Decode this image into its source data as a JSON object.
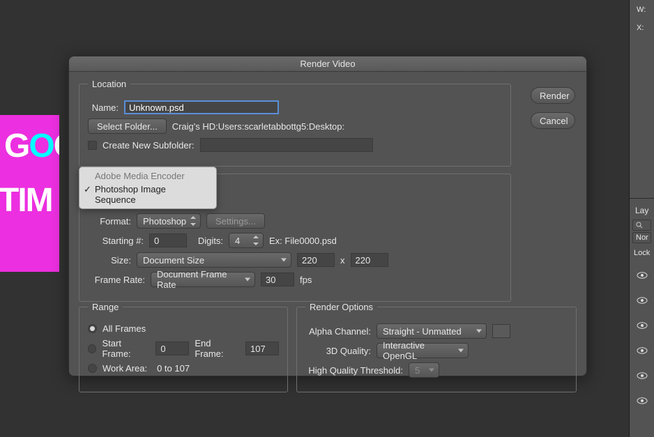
{
  "right_panel": {
    "w_label": "W:",
    "x_label": "X:",
    "layers_tab": "Lay",
    "none_label": "Nor",
    "lock_label": "Lock"
  },
  "canvas": {
    "line1a": "G",
    "line1b": "O",
    "line1c": "O",
    "line2": "TIM"
  },
  "dialog": {
    "title": "Render Video",
    "actions": {
      "render": "Render",
      "cancel": "Cancel"
    },
    "location": {
      "legend": "Location",
      "name_label": "Name:",
      "name_value": "Unknown.psd",
      "select_folder": "Select Folder...",
      "path": "Craig's HD:Users:scarletabbottg5:Desktop:",
      "create_subfolder": "Create New Subfolder:",
      "subfolder_value": ""
    },
    "encoder_menu": {
      "item_disabled": "Adobe Media Encoder",
      "item_selected": "Photoshop Image Sequence"
    },
    "format_row": {
      "label": "Format:",
      "value": "Photoshop",
      "settings": "Settings..."
    },
    "starting_row": {
      "starting_label": "Starting #:",
      "starting_value": "0",
      "digits_label": "Digits:",
      "digits_value": "4",
      "example": "Ex: File0000.psd"
    },
    "size_row": {
      "label": "Size:",
      "value": "Document Size",
      "w": "220",
      "x": "x",
      "h": "220"
    },
    "fps_row": {
      "label": "Frame Rate:",
      "value": "Document Frame Rate",
      "fps_value": "30",
      "unit": "fps"
    },
    "range": {
      "legend": "Range",
      "all": "All Frames",
      "start_label": "Start Frame:",
      "start_value": "0",
      "end_label": "End Frame:",
      "end_value": "107",
      "work_area_label": "Work Area:",
      "work_area_text": "0 to 107"
    },
    "render_options": {
      "legend": "Render Options",
      "alpha_label": "Alpha Channel:",
      "alpha_value": "Straight - Unmatted",
      "quality_label": "3D Quality:",
      "quality_value": "Interactive OpenGL",
      "hq_label": "High Quality Threshold:",
      "hq_value": "5"
    }
  }
}
